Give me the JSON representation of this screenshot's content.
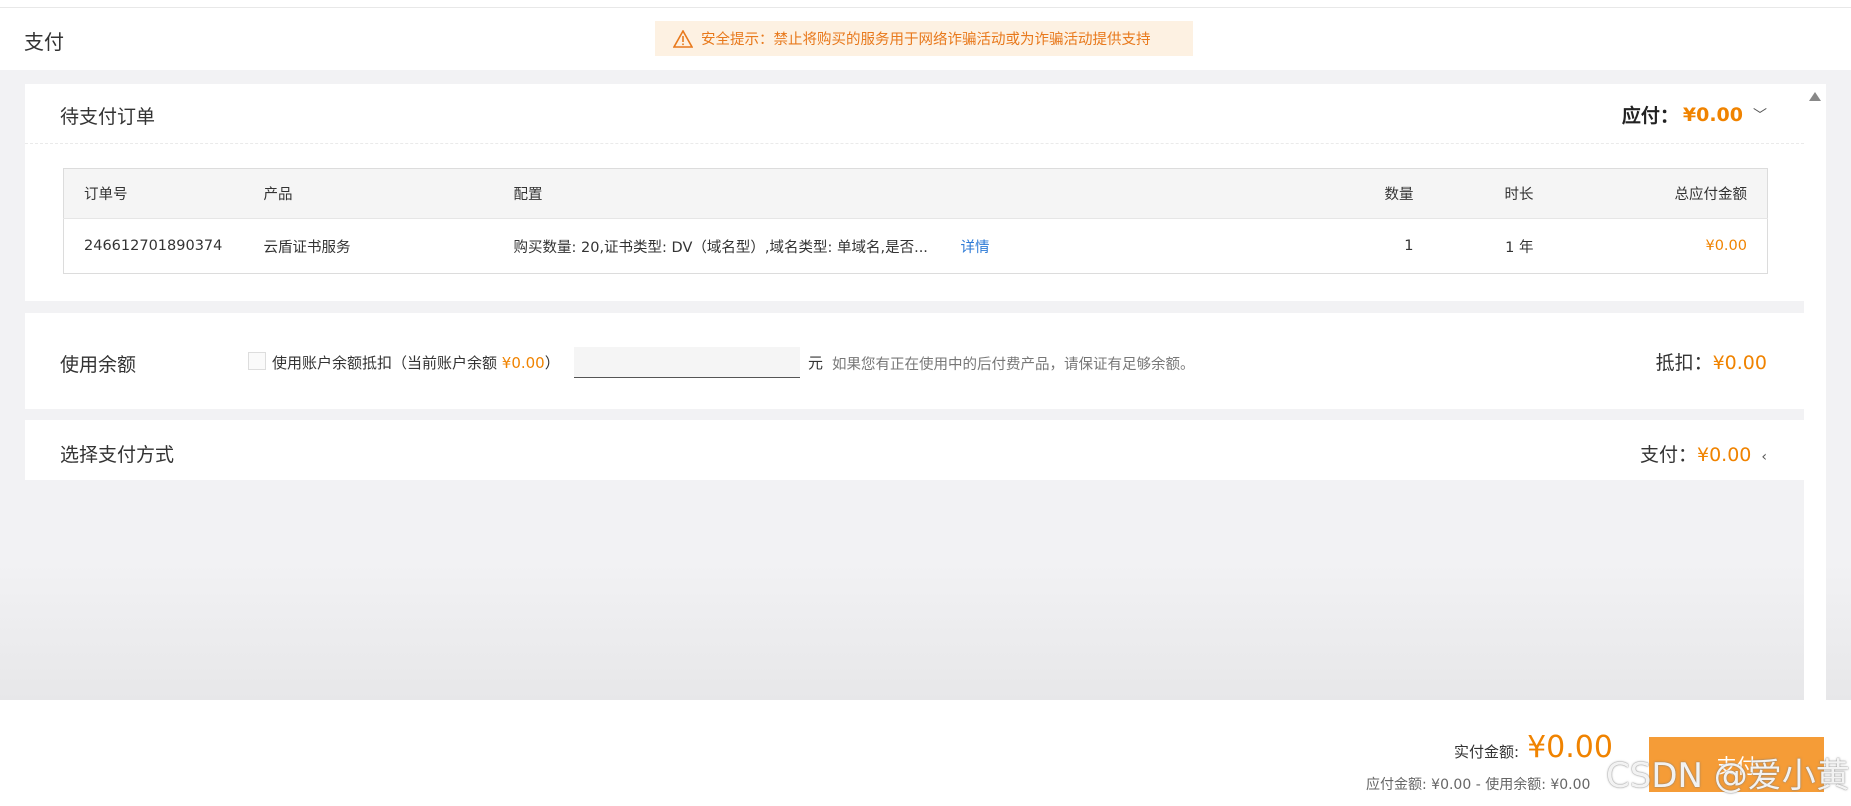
{
  "header": {
    "title": "支付",
    "notice": "安全提示：禁止将购买的服务用于网络诈骗活动或为诈骗活动提供支持"
  },
  "orders": {
    "title": "待支付订单",
    "pay_label": "应付：",
    "pay_amount": "¥0.00",
    "columns": [
      "订单号",
      "产品",
      "配置",
      "数量",
      "时长",
      "总应付金额"
    ],
    "rows": [
      {
        "order_no": "246612701890374",
        "product": "云盾证书服务",
        "config": "购买数量: 20,证书类型: DV（域名型）,域名类型: 单域名,是否...",
        "detail_link": "详情",
        "qty": "1",
        "duration": "1 年",
        "total": "¥0.00"
      }
    ]
  },
  "balance": {
    "title": "使用余额",
    "checkbox_label_pre": "使用账户余额抵扣（当前账户余额 ",
    "current_balance": "¥0.00",
    "checkbox_label_post": "）",
    "input_value": "",
    "unit": "元",
    "hint": "如果您有正在使用中的后付费产品，请保证有足够余额。",
    "deduct_label": "抵扣：",
    "deduct_amount": "¥0.00"
  },
  "payment_method": {
    "title": "选择支付方式",
    "pay_label": "支付：",
    "pay_amount": "¥0.00"
  },
  "footer": {
    "real_label": "实付金额:",
    "real_amount": "¥0.00",
    "breakdown": "应付金额: ¥0.00 - 使用余额: ¥0.00",
    "pay_button": "支付"
  },
  "watermark": "CSDN @爱小黄",
  "colors": {
    "accent": "#f08300",
    "notice_bg": "#fdf1e2",
    "button": "#f59c37",
    "link": "#2d7ad6"
  }
}
